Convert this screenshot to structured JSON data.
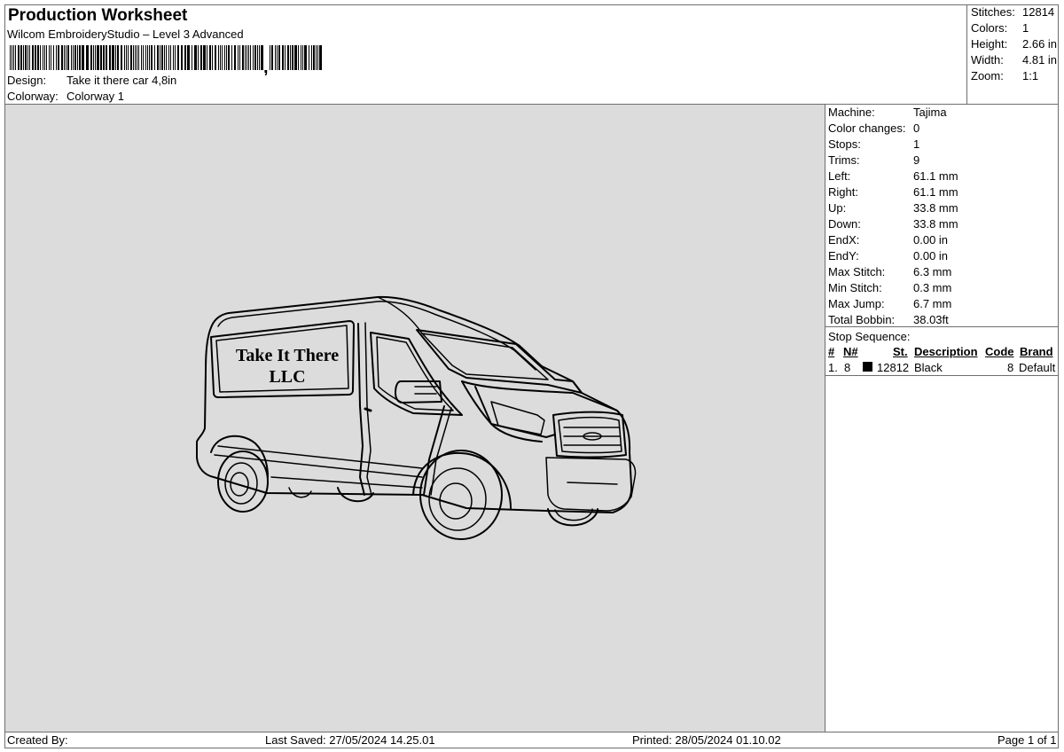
{
  "header": {
    "title": "Production Worksheet",
    "software": "Wilcom EmbroideryStudio – Level 3 Advanced",
    "design_label": "Design:",
    "design_value": "Take it there car 4,8in",
    "colorway_label": "Colorway:",
    "colorway_value": "Colorway 1"
  },
  "summary": {
    "stitches_label": "Stitches:",
    "stitches": "12814",
    "colors_label": "Colors:",
    "colors": "1",
    "height_label": "Height:",
    "height": "2.66 in",
    "width_label": "Width:",
    "width": "4.81 in",
    "zoom_label": "Zoom:",
    "zoom": "1:1"
  },
  "design": {
    "text_line1": "Take It There",
    "text_line2": "LLC",
    "thread_color": "#000000",
    "background_color": "#dcdcdc"
  },
  "machine_info": {
    "machine_label": "Machine:",
    "machine": "Tajima",
    "color_changes_label": "Color changes:",
    "color_changes": "0",
    "stops_label": "Stops:",
    "stops": "1",
    "trims_label": "Trims:",
    "trims": "9",
    "left_label": "Left:",
    "left": "61.1 mm",
    "right_label": "Right:",
    "right": "61.1 mm",
    "up_label": "Up:",
    "up": "33.8 mm",
    "down_label": "Down:",
    "down": "33.8 mm",
    "endx_label": "EndX:",
    "endx": "0.00 in",
    "endy_label": "EndY:",
    "endy": "0.00 in",
    "max_stitch_label": "Max Stitch:",
    "max_stitch": "6.3 mm",
    "min_stitch_label": "Min Stitch:",
    "min_stitch": "0.3 mm",
    "max_jump_label": "Max Jump:",
    "max_jump": "6.7 mm",
    "total_bobbin_label": "Total Bobbin:",
    "total_bobbin": "38.03ft"
  },
  "stop_sequence": {
    "title": "Stop Sequence:",
    "headers": {
      "index": "#",
      "needle": "N#",
      "stitches": "St.",
      "description": "Description",
      "code": "Code",
      "brand": "Brand"
    },
    "rows": [
      {
        "index": "1.",
        "needle": "8",
        "color": "#000000",
        "stitches": "12812",
        "description": "Black",
        "code": "8",
        "brand": "Default"
      }
    ]
  },
  "footer": {
    "created_by": "Created By:",
    "last_saved": "Last Saved: 27/05/2024 14.25.01",
    "printed": "Printed: 28/05/2024 01.10.02",
    "page": "Page 1 of 1"
  }
}
